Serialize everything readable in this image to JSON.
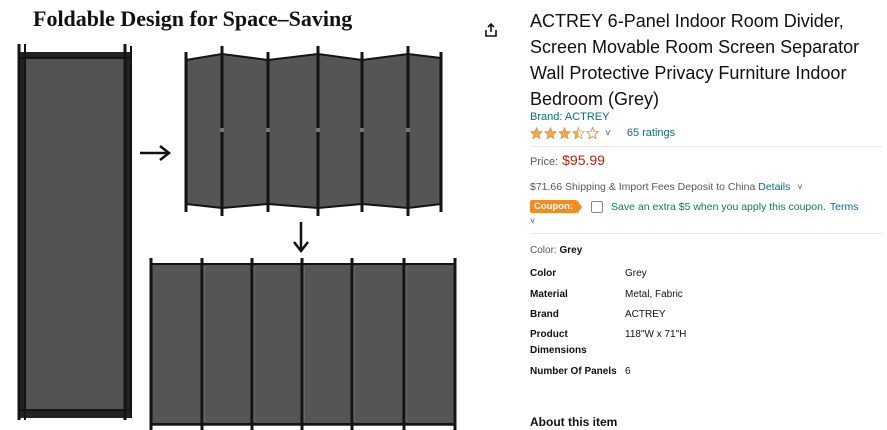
{
  "image": {
    "heading": "Foldable Design for Space–Saving",
    "arrow_right": "→",
    "arrow_down": "↓",
    "panel_color": "#525252",
    "frame_color": "#141414"
  },
  "share": {
    "icon": "share-icon"
  },
  "product": {
    "title": "ACTREY 6-Panel Indoor Room Divider, Screen Movable Room Screen Separator Wall Protective Privacy Furniture Indoor Bedroom (Grey)",
    "brand_link": "Brand: ACTREY",
    "rating_stars": 3.5,
    "rating_caret": "˅",
    "ratings_count": "65 ratings",
    "price_label": "Price:",
    "price": "$95.99",
    "shipping_text": "$71.66 Shipping & Import Fees Deposit to China",
    "shipping_details_link": "Details",
    "shipping_caret": "˅",
    "coupon_badge": "Coupon:",
    "coupon_text": "Save an extra $5 when you apply this coupon.",
    "coupon_terms": "Terms",
    "coupon_caret": "˅",
    "color_label": "Color:",
    "color_value": "Grey",
    "specs": [
      {
        "key": "Color",
        "value": "Grey"
      },
      {
        "key": "Material",
        "value": "Metal, Fabric"
      },
      {
        "key": "Brand",
        "value": "ACTREY"
      },
      {
        "key": "Product Dimensions",
        "value": "118\"W x 71\"H"
      },
      {
        "key": "Number Of Panels",
        "value": "6"
      }
    ],
    "about_heading": "About this item"
  },
  "colors": {
    "link": "#007185",
    "price": "#b12704",
    "star": "#f3a847",
    "coupon": "#f38b1f",
    "coupon_text": "#067d62"
  }
}
